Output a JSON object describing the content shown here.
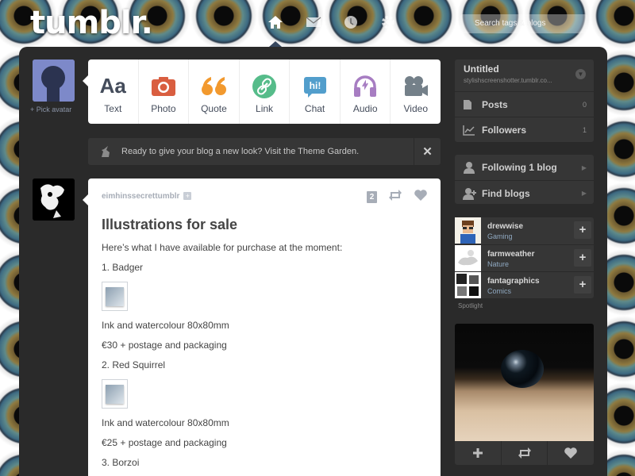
{
  "header": {
    "logo": "tumblr.",
    "search_placeholder": "Search tags & blogs"
  },
  "avatar": {
    "caption": "+ Pick avatar"
  },
  "post_types": [
    {
      "label": "Text",
      "icon": "text-icon",
      "color": "#444c5b"
    },
    {
      "label": "Photo",
      "icon": "camera-icon",
      "color": "#d95e40"
    },
    {
      "label": "Quote",
      "icon": "quote-icon",
      "color": "#f2992e"
    },
    {
      "label": "Link",
      "icon": "link-icon",
      "color": "#56bc8a"
    },
    {
      "label": "Chat",
      "icon": "chat-icon",
      "color": "#529ecc"
    },
    {
      "label": "Audio",
      "icon": "headphones-icon",
      "color": "#a77dc2"
    },
    {
      "label": "Video",
      "icon": "video-camera-icon",
      "color": "#748089"
    }
  ],
  "notice": {
    "text": "Ready to give your blog a new look? Visit the Theme Garden.",
    "close": "✕"
  },
  "post": {
    "author": "eimhinssecrettumblr",
    "follow": "+",
    "notes": "2",
    "title": "Illustrations for sale",
    "intro": "Here’s what I have available for purchase at the moment:",
    "item1": "1. Badger",
    "item1_medium": "Ink and watercolour 80x80mm",
    "item1_price": "€30 + postage and packaging",
    "item2": "2. Red Squirrel",
    "item2_medium": "Ink and watercolour 80x80mm",
    "item2_price": "€25 + postage and packaging",
    "item3": "3. Borzoi"
  },
  "sidebar": {
    "blog_title": "Untitled",
    "blog_url": "stylishscreenshotter.tumblr.co...",
    "posts_label": "Posts",
    "posts_count": "0",
    "followers_label": "Followers",
    "followers_count": "1",
    "following_label": "Following 1 blog",
    "find_label": "Find blogs",
    "spotlight": [
      {
        "name": "drewwise",
        "category": "Gaming"
      },
      {
        "name": "farmweather",
        "category": "Nature"
      },
      {
        "name": "fantagraphics",
        "category": "Comics"
      }
    ],
    "spotlight_caption": "Spotlight"
  }
}
